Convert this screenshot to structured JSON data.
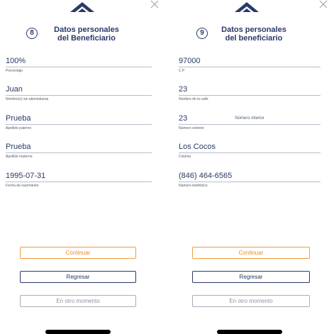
{
  "colors": {
    "navy": "#2a3a67",
    "orange": "#f08a1c",
    "gray": "#8e94a2"
  },
  "left": {
    "step": "8",
    "title_line1": "Datos personales",
    "title_line2": "del Beneficiario",
    "fields": [
      {
        "value": "100%",
        "label": "Porcentaje"
      },
      {
        "value": "Juan",
        "label": "Nombre(s) sin abreviaturas"
      },
      {
        "value": "Prueba",
        "label": "Apellido paterno"
      },
      {
        "value": "Prueba",
        "label": "Apellido materno"
      },
      {
        "value": "1995-07-31",
        "label": "Fecha de nacimiento"
      }
    ],
    "buttons": {
      "continue": "Continuar",
      "back": "Regresar",
      "later": "En otro momento"
    }
  },
  "right": {
    "step": "9",
    "title_line1": "Datos personales",
    "title_line2": "del beneficiario",
    "fields": [
      {
        "value": "97000",
        "label": "C.P"
      },
      {
        "value": "23",
        "label": "Nombre de la calle"
      },
      {
        "value": "23",
        "label": "Número exterior"
      },
      {
        "value": "",
        "placeholder": "Número interior"
      },
      {
        "value": "Los Cocos",
        "label": "Colonia"
      },
      {
        "value": "(846) 464-6565",
        "label": "Número telefónico"
      }
    ],
    "buttons": {
      "continue": "Continuar",
      "back": "Regresar",
      "later": "En otro momento"
    }
  }
}
